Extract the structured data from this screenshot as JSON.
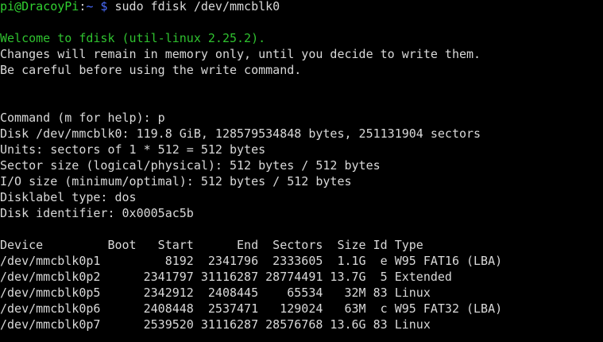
{
  "colors": {
    "background": "#000000",
    "text": "#d9d9d9",
    "prompt_user": "#31d131",
    "prompt_path": "#4a6cff",
    "welcome": "#2fc12f"
  },
  "prompt": {
    "user_host": "pi@DracoyPi",
    "separator": ":",
    "path": "~ $",
    "command": " sudo fdisk /dev/mmcblk0"
  },
  "messages": {
    "welcome": "Welcome to fdisk (util-linux 2.25.2).",
    "changes": "Changes will remain in memory only, until you decide to write them.",
    "careful": "Be careful before using the write command."
  },
  "command_line": "Command (m for help): p",
  "disk_info": [
    "Disk /dev/mmcblk0: 119.8 GiB, 128579534848 bytes, 251131904 sectors",
    "Units: sectors of 1 * 512 = 512 bytes",
    "Sector size (logical/physical): 512 bytes / 512 bytes",
    "I/O size (minimum/optimal): 512 bytes / 512 bytes",
    "Disklabel type: dos",
    "Disk identifier: 0x0005ac5b"
  ],
  "partition_table": {
    "header": "Device         Boot   Start      End  Sectors  Size Id Type",
    "rows": [
      "/dev/mmcblk0p1         8192  2341796  2333605  1.1G  e W95 FAT16 (LBA)",
      "/dev/mmcblk0p2      2341797 31116287 28774491 13.7G  5 Extended",
      "/dev/mmcblk0p5      2342912  2408445    65534   32M 83 Linux",
      "/dev/mmcblk0p6      2408448  2537471   129024   63M  c W95 FAT32 (LBA)",
      "/dev/mmcblk0p7      2539520 31116287 28576768 13.6G 83 Linux"
    ]
  }
}
